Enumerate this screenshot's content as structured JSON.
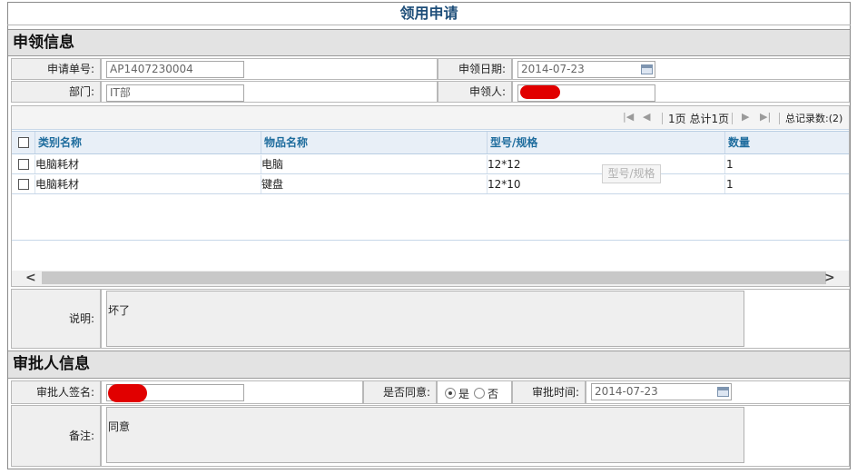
{
  "page": {
    "title": "领用申请"
  },
  "requisition": {
    "section_title": "申领信息",
    "request_no_label": "申请单号:",
    "request_no_value": "AP1407230004",
    "date_label": "申领日期:",
    "date_value": "2014-07-23",
    "department_label": "部门:",
    "department_value": "IT部",
    "requester_label": "申领人:"
  },
  "pager": {
    "page_info": "1页 总计1页",
    "total_records": "总记录数:(2)"
  },
  "grid": {
    "columns": [
      "类别名称",
      "物品名称",
      "型号/规格",
      "数量"
    ],
    "rows": [
      {
        "category": "电脑耗材",
        "item": "电脑",
        "spec": "12*12",
        "qty": "1"
      },
      {
        "category": "电脑耗材",
        "item": "键盘",
        "spec": "12*10",
        "qty": "1"
      }
    ],
    "tooltip": "型号/规格"
  },
  "description": {
    "label": "说明:",
    "value": "坏了"
  },
  "approval": {
    "section_title": "审批人信息",
    "signer_label": "审批人签名:",
    "agree_label": "是否同意:",
    "yes_label": "是",
    "no_label": "否",
    "selected": "yes",
    "time_label": "审批时间:",
    "time_value": "2014-07-23",
    "remark_label": "备注:",
    "remark_value": "同意"
  },
  "colors": {
    "title": "#1e4e79",
    "grid_header_text": "#1f6d9e",
    "redaction": "#e10000"
  }
}
